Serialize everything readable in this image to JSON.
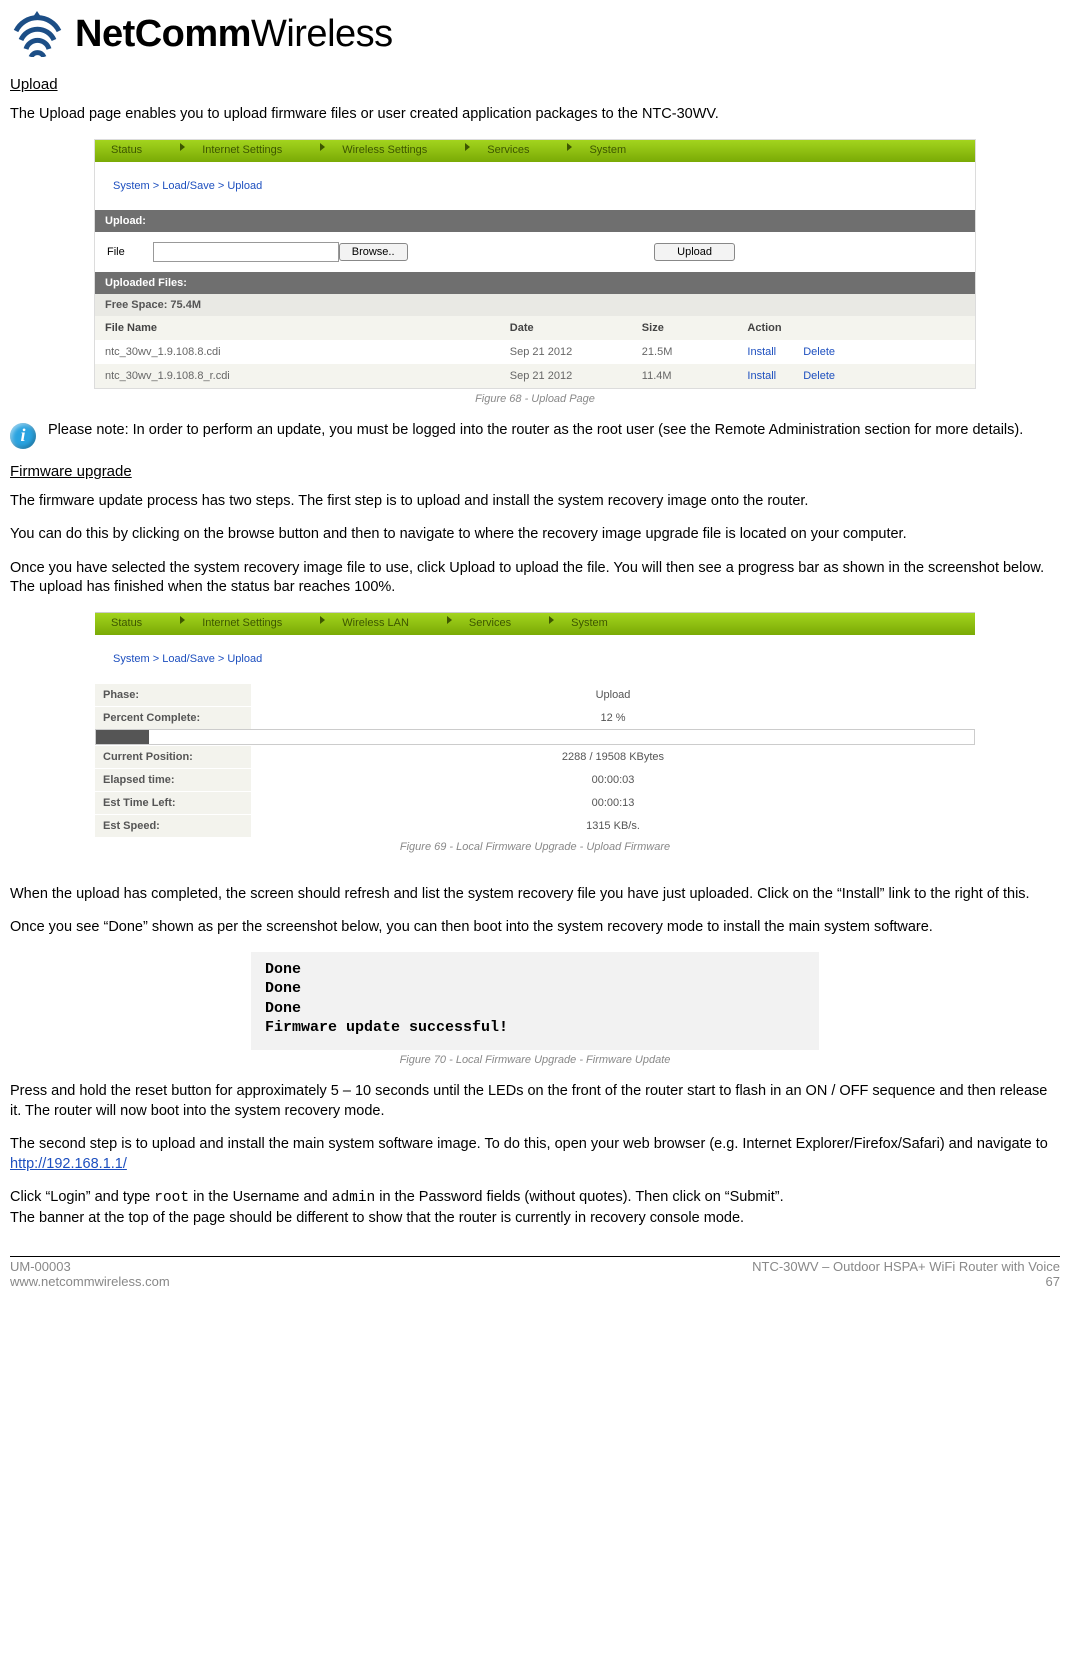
{
  "brand": {
    "name_main": "NetComm",
    "name_sub": "Wireless"
  },
  "sec_upload_title": "Upload",
  "para_upload_intro": "The Upload page enables you to upload firmware files or user created application packages to the NTC-30WV.",
  "shot1": {
    "nav": [
      "Status",
      "Internet Settings",
      "Wireless Settings",
      "Services",
      "System"
    ],
    "breadcrumb": "System > Load/Save > Upload",
    "upload_header": "Upload:",
    "file_label": "File",
    "browse_btn": "Browse..",
    "upload_btn": "Upload",
    "uploaded_header": "Uploaded Files:",
    "free_space": "Free Space: 75.4M",
    "cols": {
      "name": "File Name",
      "date": "Date",
      "size": "Size",
      "action": "Action"
    },
    "install_label": "Install",
    "delete_label": "Delete",
    "rows": [
      {
        "name": "ntc_30wv_1.9.108.8.cdi",
        "date": "Sep 21 2012",
        "size": "21.5M"
      },
      {
        "name": "ntc_30wv_1.9.108.8_r.cdi",
        "date": "Sep 21 2012",
        "size": "11.4M"
      }
    ]
  },
  "fig68": "Figure 68 - Upload Page",
  "note_text": "Please note: In order to perform an update, you must be logged into the router as the root user (see the Remote Administration section for more details).",
  "sec_fw_title": "Firmware upgrade",
  "para_fw_1": "The firmware update process has two steps. The first step is to upload and install the system recovery image onto the router.",
  "para_fw_2": "You can do this by clicking on the browse button and then to navigate to where the recovery image upgrade file is located on your computer.",
  "para_fw_3": "Once you have selected the system recovery image file to use, click Upload to upload the file. You will then see a progress bar as shown in the screenshot below. The upload has finished when the status bar reaches 100%.",
  "shot2": {
    "nav": [
      "Status",
      "Internet Settings",
      "Wireless LAN",
      "Services",
      "System"
    ],
    "breadcrumb": "System > Load/Save > Upload",
    "phase_lab": "Phase:",
    "phase_val": "Upload",
    "percent_lab": "Percent Complete:",
    "percent_val": "12 %",
    "pos_lab": "Current Position:",
    "pos_val": "2288 / 19508 KBytes",
    "elapsed_lab": "Elapsed time:",
    "elapsed_val": "00:00:03",
    "left_lab": "Est Time Left:",
    "left_val": "00:00:13",
    "speed_lab": "Est Speed:",
    "speed_val": "1315 KB/s."
  },
  "fig69": "Figure 69 - Local Firmware Upgrade - Upload Firmware",
  "para_after_upload_1": "When the upload has completed, the screen should refresh and list the system recovery file you have just uploaded. Click on the “Install” link to the right of this.",
  "para_after_upload_2": "Once you see “Done” shown as per the screenshot below, you can then boot into the system recovery mode to install the main system software.",
  "done_lines": [
    "Done",
    "Done",
    "Done",
    "Firmware update successful!"
  ],
  "fig70": "Figure 70 - Local Firmware Upgrade - Firmware Update",
  "para_reset": "Press and hold the reset button for approximately 5 – 10 seconds until the LEDs on the front of the router start to flash in an ON / OFF sequence and then release it. The router will now boot into the system recovery mode.",
  "para_step2_pre": "The second step is to upload and install the main system software image. To do this, open your web browser (e.g. Internet Explorer/Firefox/Safari) and navigate to ",
  "router_url": "http://192.168.1.1/",
  "login_pre": "Click “Login” and type ",
  "login_root": "root",
  "login_mid": " in the Username and ",
  "login_admin": "admin",
  "login_post": " in the Password fields (without quotes). Then click on “Submit”.",
  "banner_line": "The banner at the top of the page should be different to show that the router is currently in recovery console mode.",
  "footer": {
    "doc_id": "UM-00003",
    "site": "www.netcommwireless.com",
    "product": "NTC-30WV – Outdoor HSPA+ WiFi Router with Voice",
    "page": "67"
  }
}
